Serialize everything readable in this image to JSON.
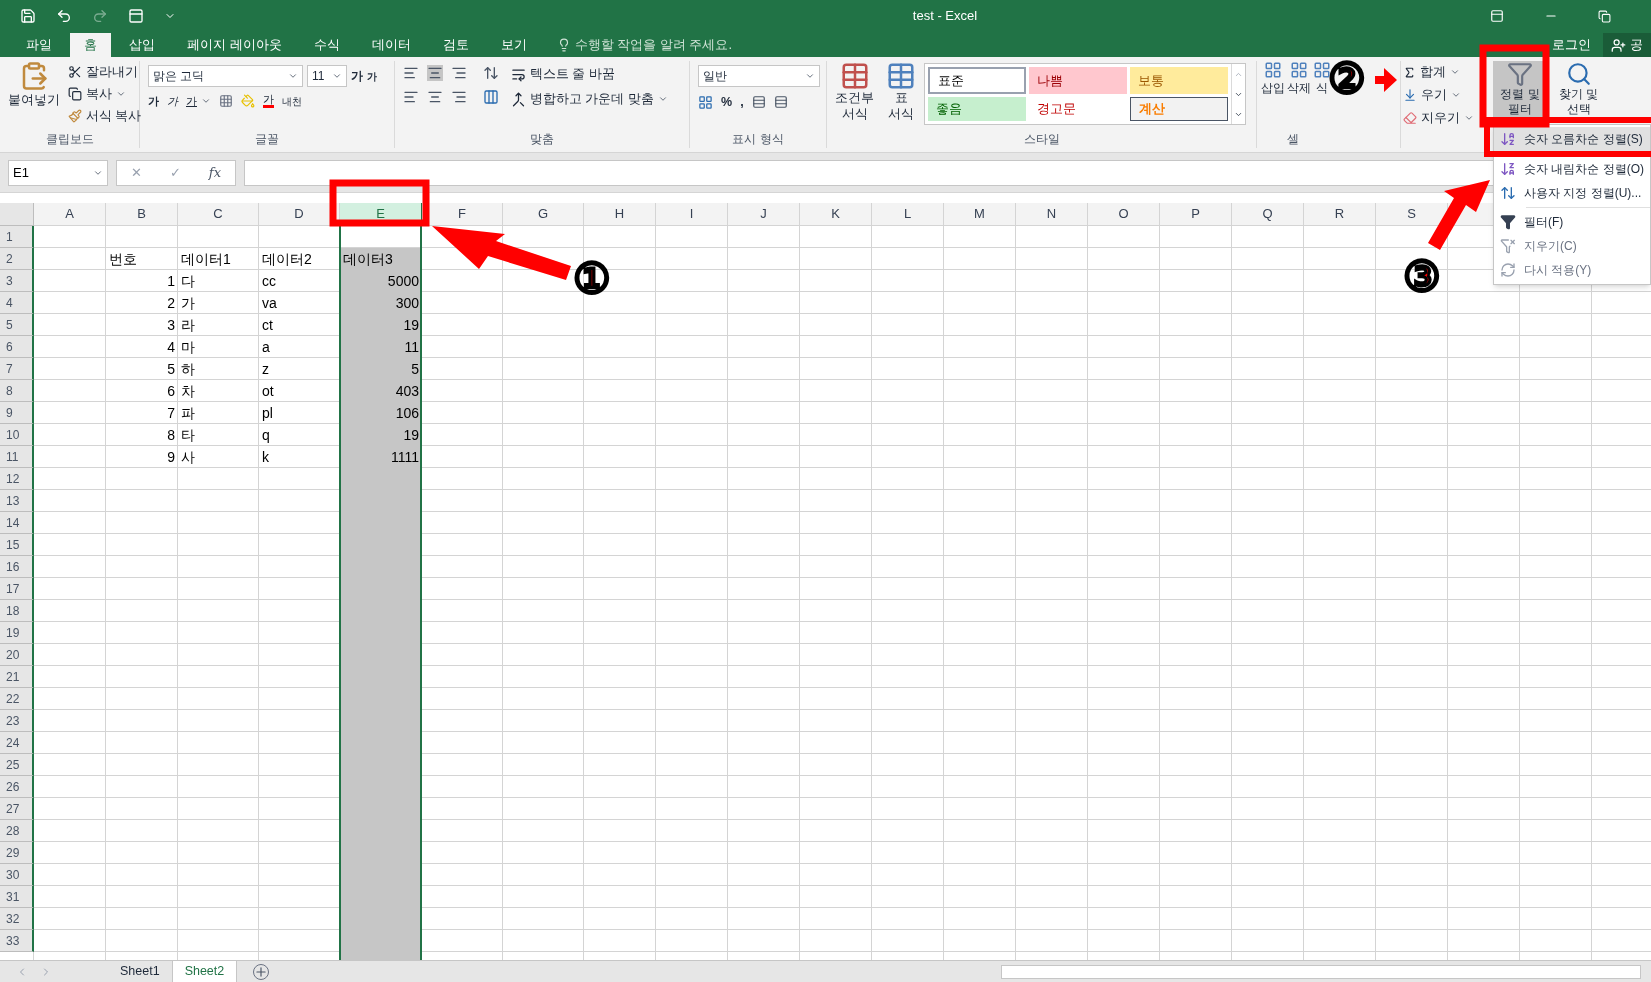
{
  "title_bar": {
    "title": "test - Excel"
  },
  "ribbon_tabs": [
    {
      "label": "파일",
      "selected": false
    },
    {
      "label": "홈",
      "selected": true
    },
    {
      "label": "삽입",
      "selected": false
    },
    {
      "label": "페이지 레이아웃",
      "selected": false
    },
    {
      "label": "수식",
      "selected": false
    },
    {
      "label": "데이터",
      "selected": false
    },
    {
      "label": "검토",
      "selected": false
    },
    {
      "label": "보기",
      "selected": false
    }
  ],
  "tell_me": "수행할 작업을 알려 주세요.",
  "login": "로그인",
  "share": "공",
  "clipboard": {
    "paste": "붙여넣기",
    "cut": "잘라내기",
    "copy": "복사",
    "format_painter": "서식 복사",
    "label": "클립보드"
  },
  "font": {
    "name": "맑은 고딕",
    "size": "11",
    "grow": "가",
    "shrink": "가",
    "bold": "가",
    "italic": "가",
    "underline": "가",
    "font_color": "가",
    "phonetic": "내천",
    "label": "글꼴"
  },
  "alignment": {
    "wrap": "텍스트 줄 바꿈",
    "merge": "병합하고 가운데 맞춤",
    "label": "맞춤"
  },
  "number": {
    "format": "일반",
    "percent": "%",
    "comma": ",",
    "label": "표시 형식"
  },
  "styles": {
    "conditional": [
      "조건부",
      "서식"
    ],
    "table": [
      "표",
      "서식"
    ],
    "label": "스타일",
    "cells": [
      {
        "label": "표준",
        "kind": "normal"
      },
      {
        "label": "나쁨",
        "kind": "bad"
      },
      {
        "label": "보통",
        "kind": "neutral"
      },
      {
        "label": "좋음",
        "kind": "good"
      },
      {
        "label": "경고문",
        "kind": "warning"
      },
      {
        "label": "계산",
        "kind": "calculation"
      }
    ]
  },
  "cells_group": {
    "insert": "삽입",
    "delete": "삭제",
    "format": "식",
    "label": "셀"
  },
  "editing": {
    "sum": "합계",
    "fill": "우기",
    "clear": "지우기",
    "sort": [
      "정렬 및",
      "필터"
    ],
    "find": [
      "찾기 및",
      "선택"
    ]
  },
  "formula_bar": {
    "name_box": "E1",
    "cancel": "✕",
    "enter": "✓",
    "fx": "fx"
  },
  "columns": [
    {
      "label": "A",
      "selected": false
    },
    {
      "label": "B",
      "selected": false
    },
    {
      "label": "C",
      "selected": false
    },
    {
      "label": "D",
      "selected": false
    },
    {
      "label": "E",
      "selected": true
    },
    {
      "label": "F",
      "selected": false
    },
    {
      "label": "G",
      "selected": false
    },
    {
      "label": "H",
      "selected": false
    },
    {
      "label": "I",
      "selected": false
    },
    {
      "label": "J",
      "selected": false
    },
    {
      "label": "K",
      "selected": false
    },
    {
      "label": "L",
      "selected": false
    },
    {
      "label": "M",
      "selected": false
    },
    {
      "label": "N",
      "selected": false
    },
    {
      "label": "O",
      "selected": false
    },
    {
      "label": "P",
      "selected": false
    },
    {
      "label": "Q",
      "selected": false
    },
    {
      "label": "R",
      "selected": false
    },
    {
      "label": "S",
      "selected": false
    }
  ],
  "rows": [
    {
      "header": "1"
    },
    {
      "header": "2",
      "cells": [
        null,
        {
          "text": "번호",
          "kind": "text"
        },
        {
          "text": "데이터1",
          "kind": "text"
        },
        {
          "text": "데이터2",
          "kind": "text"
        },
        {
          "text": "데이터3",
          "kind": "text"
        }
      ]
    },
    {
      "header": "3",
      "cells": [
        null,
        {
          "text": "1",
          "kind": "number"
        },
        {
          "text": "다",
          "kind": "text"
        },
        {
          "text": "cc",
          "kind": "text"
        },
        {
          "text": "5000",
          "kind": "number"
        }
      ]
    },
    {
      "header": "4",
      "cells": [
        null,
        {
          "text": "2",
          "kind": "number"
        },
        {
          "text": "가",
          "kind": "text"
        },
        {
          "text": "va",
          "kind": "text"
        },
        {
          "text": "300",
          "kind": "number"
        }
      ]
    },
    {
      "header": "5",
      "cells": [
        null,
        {
          "text": "3",
          "kind": "number"
        },
        {
          "text": "라",
          "kind": "text"
        },
        {
          "text": "ct",
          "kind": "text"
        },
        {
          "text": "19",
          "kind": "number"
        }
      ]
    },
    {
      "header": "6",
      "cells": [
        null,
        {
          "text": "4",
          "kind": "number"
        },
        {
          "text": "마",
          "kind": "text"
        },
        {
          "text": "a",
          "kind": "text"
        },
        {
          "text": "11",
          "kind": "number"
        }
      ]
    },
    {
      "header": "7",
      "cells": [
        null,
        {
          "text": "5",
          "kind": "number"
        },
        {
          "text": "하",
          "kind": "text"
        },
        {
          "text": "z",
          "kind": "text"
        },
        {
          "text": "5",
          "kind": "number"
        }
      ]
    },
    {
      "header": "8",
      "cells": [
        null,
        {
          "text": "6",
          "kind": "number"
        },
        {
          "text": "차",
          "kind": "text"
        },
        {
          "text": "ot",
          "kind": "text"
        },
        {
          "text": "403",
          "kind": "number"
        }
      ]
    },
    {
      "header": "9",
      "cells": [
        null,
        {
          "text": "7",
          "kind": "number"
        },
        {
          "text": "파",
          "kind": "text"
        },
        {
          "text": "pl",
          "kind": "text"
        },
        {
          "text": "106",
          "kind": "number"
        }
      ]
    },
    {
      "header": "10",
      "cells": [
        null,
        {
          "text": "8",
          "kind": "number"
        },
        {
          "text": "타",
          "kind": "text"
        },
        {
          "text": "q",
          "kind": "text"
        },
        {
          "text": "19",
          "kind": "number"
        }
      ]
    },
    {
      "header": "11",
      "cells": [
        null,
        {
          "text": "9",
          "kind": "number"
        },
        {
          "text": "사",
          "kind": "text"
        },
        {
          "text": "k",
          "kind": "text"
        },
        {
          "text": "1111",
          "kind": "number"
        }
      ]
    },
    {
      "header": "12"
    },
    {
      "header": "13"
    },
    {
      "header": "14"
    },
    {
      "header": "15"
    },
    {
      "header": "16"
    },
    {
      "header": "17"
    },
    {
      "header": "18"
    },
    {
      "header": "19"
    },
    {
      "header": "20"
    },
    {
      "header": "21"
    },
    {
      "header": "22"
    },
    {
      "header": "23"
    },
    {
      "header": "24"
    },
    {
      "header": "25"
    },
    {
      "header": "26"
    },
    {
      "header": "27"
    },
    {
      "header": "28"
    },
    {
      "header": "29"
    },
    {
      "header": "30"
    },
    {
      "header": "31"
    },
    {
      "header": "32"
    },
    {
      "header": "33"
    }
  ],
  "sort_menu": [
    {
      "label": "숫자 오름차순 정렬(S)",
      "kind": "sort_asc",
      "disabled": false,
      "selected": true
    },
    {
      "label": "숫자 내림차순 정렬(O)",
      "kind": "sort_desc",
      "disabled": false,
      "selected": false
    },
    {
      "label": "사용자 지정 정렬(U)...",
      "kind": "custom_sort",
      "disabled": false,
      "selected": false
    },
    {
      "label": "필터(F)",
      "kind": "filter",
      "disabled": false,
      "selected": false
    },
    {
      "label": "지우기(C)",
      "kind": "clear",
      "disabled": true,
      "selected": false
    },
    {
      "label": "다시 적용(Y)",
      "kind": "reapply",
      "disabled": true,
      "selected": false
    }
  ],
  "sheet_tabs": [
    {
      "label": "Sheet1",
      "selected": false
    },
    {
      "label": "Sheet2",
      "selected": true
    }
  ],
  "annotations": [
    {
      "label": "①",
      "kind": "column"
    },
    {
      "label": "②",
      "kind": "sort_button"
    },
    {
      "label": "③",
      "kind": "menu_item"
    }
  ]
}
